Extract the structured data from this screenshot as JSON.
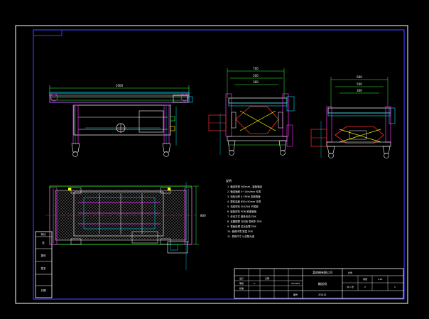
{
  "drawing": {
    "background": "#000000",
    "colors": {
      "frame": "#ffffff",
      "border_blue": "#3a3aff",
      "cyan": "#00e5ff",
      "green": "#38ff38",
      "magenta": "#ff2cff",
      "red": "#ff3030",
      "yellow": "#ffff00",
      "white": "#ffffff",
      "mesh": "#8a8a8a"
    },
    "dimensions": {
      "front_overall": "2000",
      "side_top": "700",
      "side_mid": "500",
      "side_low": "300",
      "end_top": "600",
      "end_mid": "500",
      "end_low": "300",
      "plan_right": "800"
    },
    "notes_header": "说明",
    "notes": [
      "1. 输送带宽 500mm，链板输送",
      "2. 输送速度 0~15m/min 可调",
      "3. 电机功率 0.75kW 变频调速",
      "4. 整机高度 850±50mm 可调",
      "5. 机架材料 SUS304 不锈钢",
      "6. 链板材料 POM 耐磨链板",
      "7. 传动方式 链条传动 ZGK",
      "8. 支腿配置 万向轮 带刹车 ZGK",
      "9. 表面处理 拉丝处理 ZGK",
      "10. 使用环境 常温 ZGK",
      "11. 具体尺寸 以实物为准"
    ],
    "title_block": {
      "company": "某机械有限公司",
      "drawing_name": "输送机",
      "scale_label": "比例",
      "scale": "1:10",
      "material": "SUS304",
      "sheet_label": "共 1 张",
      "sheet": "1",
      "weight": "重量",
      "designer": "设计",
      "checker": "审核",
      "approver": "批准",
      "date": "日期",
      "drawing_no": "图号",
      "number": "ZGK-01",
      "qty": "2",
      "mark": "A"
    },
    "left_column": [
      "标记",
      "处",
      "更改",
      "签名",
      "日期"
    ]
  }
}
